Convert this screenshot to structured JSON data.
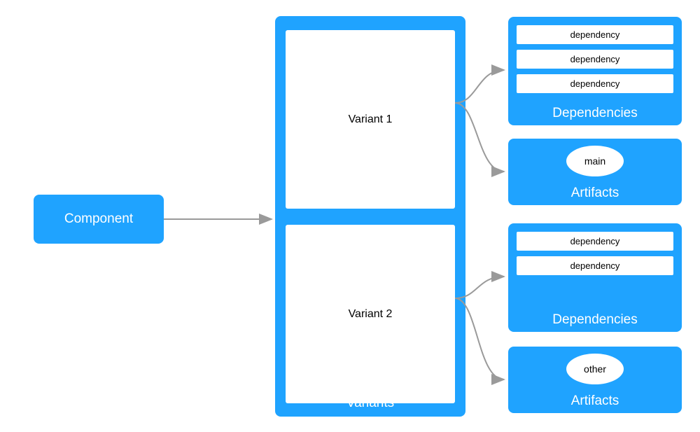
{
  "component": {
    "label": "Component"
  },
  "variants": {
    "title": "Variants",
    "items": [
      {
        "label": "Variant 1"
      },
      {
        "label": "Variant 2"
      }
    ]
  },
  "dependencies": [
    {
      "title": "Dependencies",
      "items": [
        "dependency",
        "dependency",
        "dependency"
      ]
    },
    {
      "title": "Dependencies",
      "items": [
        "dependency",
        "dependency"
      ]
    }
  ],
  "artifacts": [
    {
      "title": "Artifacts",
      "name": "main"
    },
    {
      "title": "Artifacts",
      "name": "other"
    }
  ],
  "colors": {
    "accent": "#1fa3ff",
    "arrow": "#9a9a9a"
  }
}
